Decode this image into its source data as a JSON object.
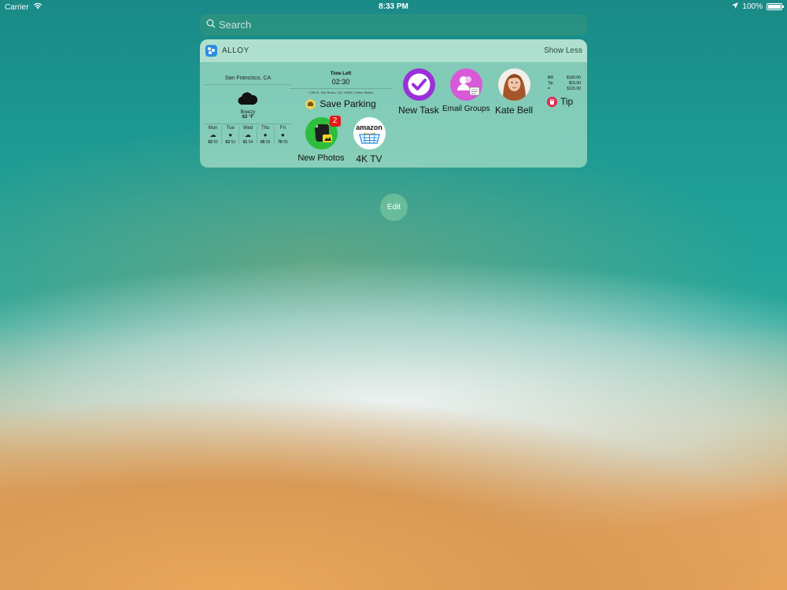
{
  "status_bar": {
    "carrier": "Carrier",
    "time": "8:33 PM",
    "battery": "100%",
    "battery_level": 1.0
  },
  "search": {
    "placeholder": "Search"
  },
  "widget": {
    "app_name": "ALLOY",
    "toggle_label": "Show Less",
    "weather": {
      "city": "San Francisco, CA",
      "condition": "Breezy",
      "temperature": "62 °F",
      "forecast": [
        {
          "day": "Mon",
          "high": "62",
          "low": "55"
        },
        {
          "day": "Tue",
          "high": "62",
          "low": "53"
        },
        {
          "day": "Wed",
          "high": "61",
          "low": "54"
        },
        {
          "day": "Thu",
          "high": "65",
          "low": "55"
        },
        {
          "day": "Fri",
          "high": "70",
          "low": "55"
        }
      ]
    },
    "parking": {
      "time_left_label": "Time Left",
      "time_left": "02:30",
      "address": "I-280 N, San Bruno, CA, 94066, United States",
      "action_label": "Save Parking"
    },
    "actions": {
      "new_task": "New Task",
      "email_groups": "Email Groups",
      "kate_bell": "Kate Bell",
      "new_photos": "New Photos",
      "new_photos_badge": "2",
      "amazon_logo_text": "amazon",
      "tv": "4K TV"
    },
    "tip_calc": {
      "bill_label": "Bill",
      "bill": "$100.00",
      "tip_label": "Tip",
      "tip": "$15.00",
      "total_label": "=",
      "total": "$115.00",
      "action_label": "Tip"
    }
  },
  "edit_label": "Edit",
  "colors": {
    "task_purple": "#9b30d9",
    "groups_pink": "#d85ad8",
    "evernote_green": "#2dbe3c",
    "tip_red": "#e2264e"
  }
}
